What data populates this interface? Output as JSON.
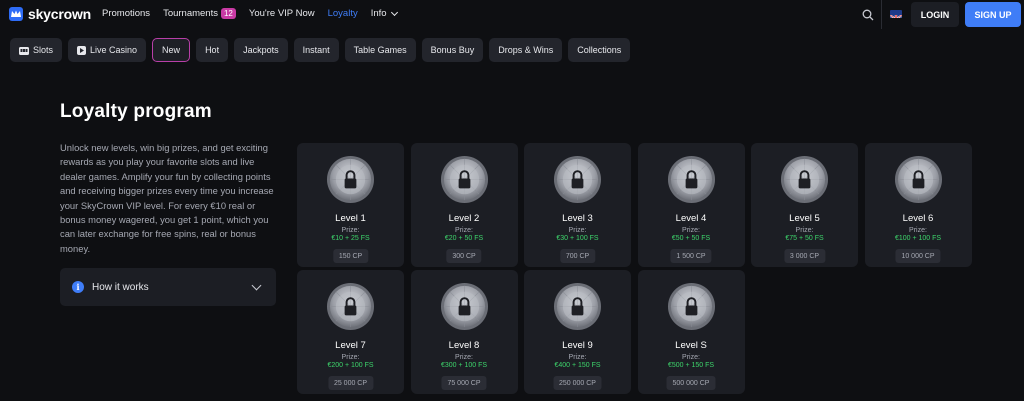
{
  "header": {
    "logo_text": "skycrown",
    "nav": [
      {
        "label": "Promotions"
      },
      {
        "label": "Tournaments",
        "badge": "12"
      },
      {
        "label": "You're VIP Now"
      },
      {
        "label": "Loyalty",
        "active": true
      },
      {
        "label": "Info",
        "dropdown": true
      }
    ],
    "language_flag": "uk-flag",
    "login_label": "LOGIN",
    "signup_label": "SIGN UP"
  },
  "categories": [
    {
      "label": "Slots",
      "icon": "slots-icon"
    },
    {
      "label": "Live Casino",
      "icon": "play-icon"
    },
    {
      "label": "New",
      "active": true
    },
    {
      "label": "Hot"
    },
    {
      "label": "Jackpots"
    },
    {
      "label": "Instant"
    },
    {
      "label": "Table Games"
    },
    {
      "label": "Bonus Buy"
    },
    {
      "label": "Drops & Wins"
    },
    {
      "label": "Collections"
    }
  ],
  "loyalty": {
    "title": "Loyalty program",
    "description": "Unlock new levels, win big prizes, and get exciting rewards as you play your favorite slots and live dealer games. Amplify your fun by collecting points and receiving bigger prizes every time you increase your SkyCrown VIP level. For every €10 real or bonus money wagered, you get 1 point, which you can later exchange for free spins, real or bonus money.",
    "how_it_works_label": "How it works",
    "prize_label": "Prize:",
    "levels": [
      {
        "name": "Level 1",
        "prize": "€10 + 25 FS",
        "cp": "150 CP"
      },
      {
        "name": "Level 2",
        "prize": "€20 + 50 FS",
        "cp": "300 CP"
      },
      {
        "name": "Level 3",
        "prize": "€30 + 100 FS",
        "cp": "700 CP"
      },
      {
        "name": "Level 4",
        "prize": "€50 + 50 FS",
        "cp": "1 500 CP"
      },
      {
        "name": "Level 5",
        "prize": "€75 + 50 FS",
        "cp": "3 000 CP"
      },
      {
        "name": "Level 6",
        "prize": "€100 + 100 FS",
        "cp": "10 000 CP"
      },
      {
        "name": "Level 7",
        "prize": "€200 + 100 FS",
        "cp": "25 000 CP"
      },
      {
        "name": "Level 8",
        "prize": "€300 + 100 FS",
        "cp": "75 000 CP"
      },
      {
        "name": "Level 9",
        "prize": "€400 + 150 FS",
        "cp": "250 000 CP"
      },
      {
        "name": "Level S",
        "prize": "€500 + 150 FS",
        "cp": "500 000 CP"
      }
    ]
  },
  "colors": {
    "accent": "#3f7df7",
    "prize_green": "#3dd46b",
    "badge_pink": "#c93aa4",
    "background": "#0e0f12",
    "card": "#1c1e24"
  }
}
